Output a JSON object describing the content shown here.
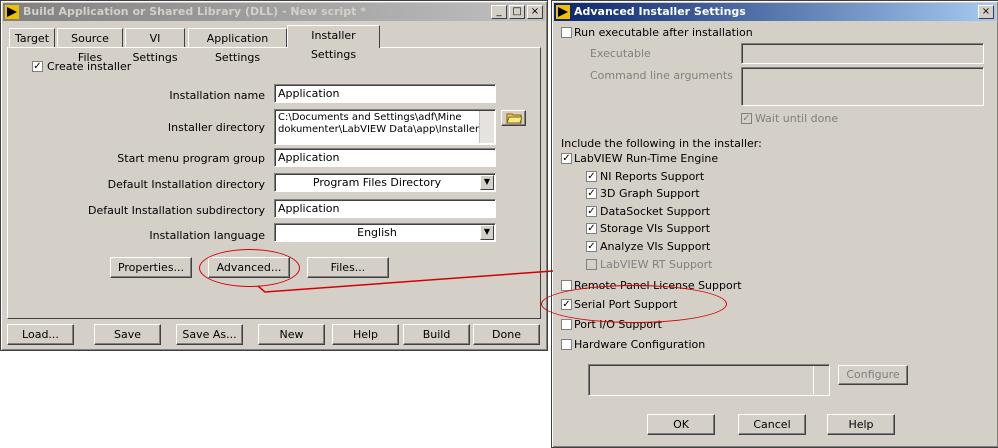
{
  "build": {
    "title": "Build Application or Shared Library (DLL) - New script *",
    "tabs": [
      "Target",
      "Source Files",
      "VI Settings",
      "Application Settings",
      "Installer Settings"
    ],
    "create_installer": "Create installer",
    "labels": {
      "installation_name": "Installation name",
      "installer_directory": "Installer directory",
      "start_menu": "Start menu program group",
      "default_dir": "Default Installation directory",
      "default_subdir": "Default Installation subdirectory",
      "language": "Installation language"
    },
    "values": {
      "installation_name": "Application",
      "installer_directory_1": "C:\\Documents and Settings\\adf\\Mine",
      "installer_directory_2": "dokumenter\\LabVIEW Data\\app\\Installer",
      "start_menu": "Application",
      "default_dir": "Program Files Directory",
      "default_subdir": "Application",
      "language": "English"
    },
    "buttons": {
      "properties": "Properties...",
      "advanced": "Advanced...",
      "files": "Files...",
      "load": "Load...",
      "save": "Save",
      "save_as": "Save As...",
      "new": "New",
      "help": "Help",
      "build": "Build",
      "done": "Done"
    }
  },
  "advanced": {
    "title": "Advanced Installer Settings",
    "run_exec": "Run executable after installation",
    "executable": "Executable",
    "cmd_args": "Command line arguments",
    "wait": "Wait until done",
    "include_header": "Include the following in the installer:",
    "runtime": "LabVIEW Run-Time Engine",
    "sub": {
      "ni_reports": "NI Reports Support",
      "graph3d": "3D Graph Support",
      "datasocket": "DataSocket Support",
      "storage": "Storage VIs Support",
      "analyze": "Analyze VIs Support",
      "rt": "LabVIEW RT Support"
    },
    "remote_panel": "Remote Panel License Support",
    "serial_port": "Serial Port Support",
    "port_io": "Port I/O Support",
    "hardware": "Hardware Configuration",
    "configure": "Configure",
    "ok": "OK",
    "cancel": "Cancel",
    "help": "Help"
  },
  "check": "✓",
  "colors": {
    "title_active": "#0a246a",
    "annotation": "#d40000"
  }
}
